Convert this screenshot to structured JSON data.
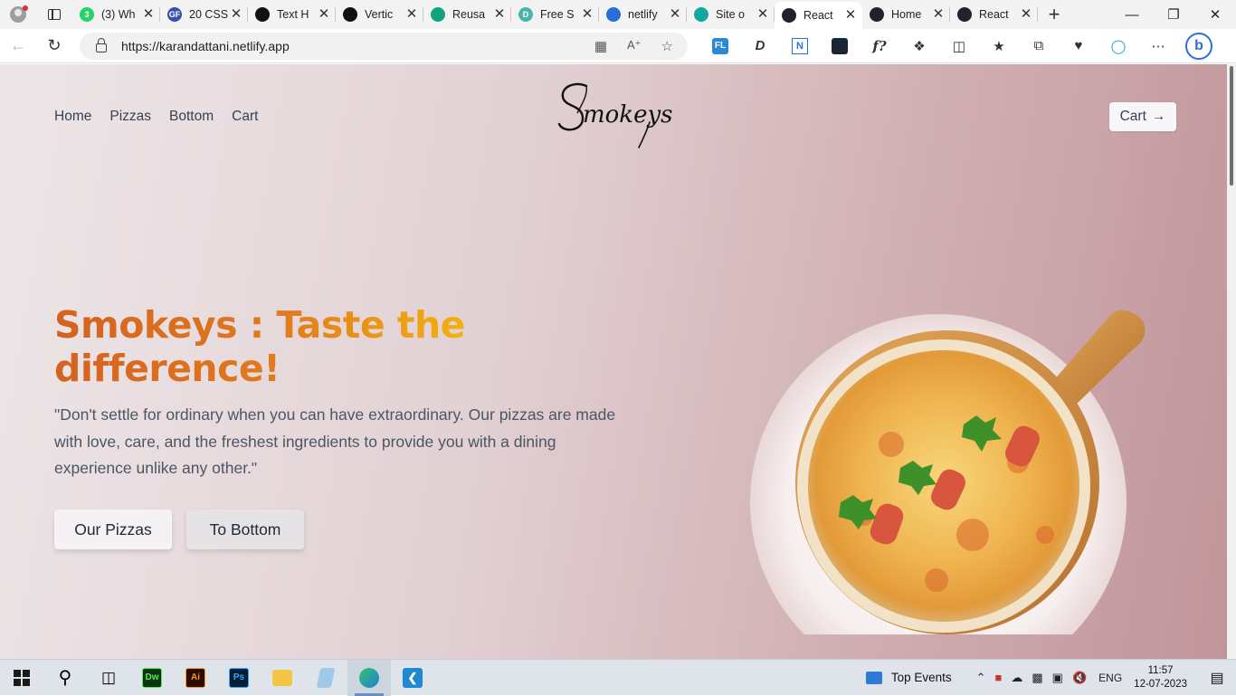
{
  "browser": {
    "tabs": [
      {
        "label": "(3) Wh",
        "favicon": "whatsapp-icon",
        "color": "#25d366",
        "badge": "3"
      },
      {
        "label": "20 CSS",
        "favicon": "geeksforgeeks-icon",
        "color": "#3651a8",
        "badge": "GF"
      },
      {
        "label": "Text H",
        "favicon": "codepen-icon",
        "color": "#111111",
        "badge": ""
      },
      {
        "label": "Vertic",
        "favicon": "codepen-icon",
        "color": "#111111",
        "badge": ""
      },
      {
        "label": "Reusa",
        "favicon": "chatgpt-icon",
        "color": "#10a37f",
        "badge": ""
      },
      {
        "label": "Free S",
        "favicon": "document-icon",
        "color": "#4cb5ab",
        "badge": "D"
      },
      {
        "label": "netlify",
        "favicon": "search-icon",
        "color": "#2b6dd8",
        "badge": ""
      },
      {
        "label": "Site o",
        "favicon": "netlify-icon",
        "color": "#14a79d",
        "badge": ""
      },
      {
        "label": "React",
        "favicon": "react-icon",
        "color": "#20232a",
        "badge": "",
        "active": true
      },
      {
        "label": "Home",
        "favicon": "react-icon",
        "color": "#20232a",
        "badge": ""
      },
      {
        "label": "React",
        "favicon": "react-icon",
        "color": "#20232a",
        "badge": ""
      }
    ],
    "url": "https://karandattani.netlify.app",
    "new_tab": "+",
    "ext_fl": "FL",
    "ext_n": "N",
    "ext_f": "f?",
    "ext_d": "D",
    "bing": "b"
  },
  "site": {
    "nav": [
      "Home",
      "Pizzas",
      "Bottom",
      "Cart"
    ],
    "logo_text": "Smokeys",
    "cart_button": "Cart",
    "hero_title": "Smokeys : Taste the difference!",
    "hero_text": "\"Don't settle for ordinary when you can have extraordinary. Our pizzas are made with love, care, and the freshest ingredients to provide you with a dining experience unlike any other.\"",
    "button_pizzas": "Our Pizzas",
    "button_bottom": "To Bottom"
  },
  "taskbar": {
    "apps": [
      {
        "name": "dreamweaver-icon",
        "label": "Dw",
        "bg": "#0d3313",
        "fg": "#4cf04b"
      },
      {
        "name": "illustrator-icon",
        "label": "Ai",
        "bg": "#2b0a00",
        "fg": "#ff9a00"
      },
      {
        "name": "photoshop-icon",
        "label": "Ps",
        "bg": "#001e36",
        "fg": "#31a8ff"
      }
    ],
    "widget": "Top Events",
    "language": "ENG",
    "time": "11:57",
    "date": "12-07-2023"
  },
  "colors": {
    "title_start": "#d4621f",
    "title_end": "#f2b00e",
    "text": "#4b5563"
  }
}
